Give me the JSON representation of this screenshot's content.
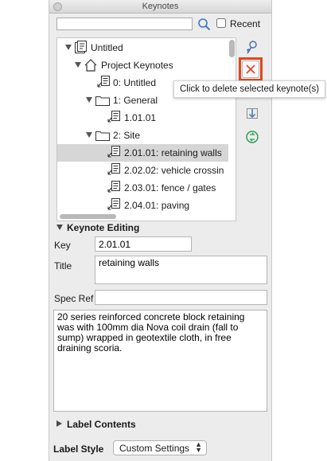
{
  "window": {
    "title": "Keynotes"
  },
  "search": {
    "value": "",
    "placeholder": "",
    "recent_label": "Recent",
    "recent_checked": false
  },
  "tree": [
    {
      "label": "Untitled",
      "kind": "file"
    },
    {
      "label": "Project Keynotes",
      "kind": "house"
    },
    {
      "label": "0: Untitled",
      "kind": "note"
    },
    {
      "label": "1: General",
      "kind": "folder"
    },
    {
      "label": "1.01.01",
      "kind": "note"
    },
    {
      "label": "2: Site",
      "kind": "folder"
    },
    {
      "label": "2.01.01: retaining walls",
      "kind": "note",
      "selected": true
    },
    {
      "label": "2.02.02: vehicle crossin",
      "kind": "note"
    },
    {
      "label": "2.03.01: fence / gates",
      "kind": "note"
    },
    {
      "label": "2.04.01: paving",
      "kind": "note"
    }
  ],
  "sidebar": {
    "icons": [
      "add-keynote-icon",
      "delete-keynote-icon",
      "import-icon",
      "refresh-icon"
    ],
    "delete_tooltip": "Click to delete selected keynote(s)"
  },
  "editing": {
    "section_title": "Keynote Editing",
    "key_label": "Key",
    "key_value": "2.01.01",
    "title_label": "Title",
    "title_value": "retaining walls",
    "specref_label": "Spec Ref",
    "specref_value": "",
    "description": "20 series reinforced concrete block retaining was with 100mm dia Nova coil drain (fall to sump) wrapped in geotextile cloth, in free draining scoria."
  },
  "label_contents": {
    "section_title": "Label Contents"
  },
  "label_style": {
    "label": "Label Style",
    "value": "Custom Settings"
  },
  "colors": {
    "highlight": "#e2461d",
    "delete_x": "#e0412b",
    "selection": "#d6d6d6",
    "link_icon": "#2aa158"
  }
}
